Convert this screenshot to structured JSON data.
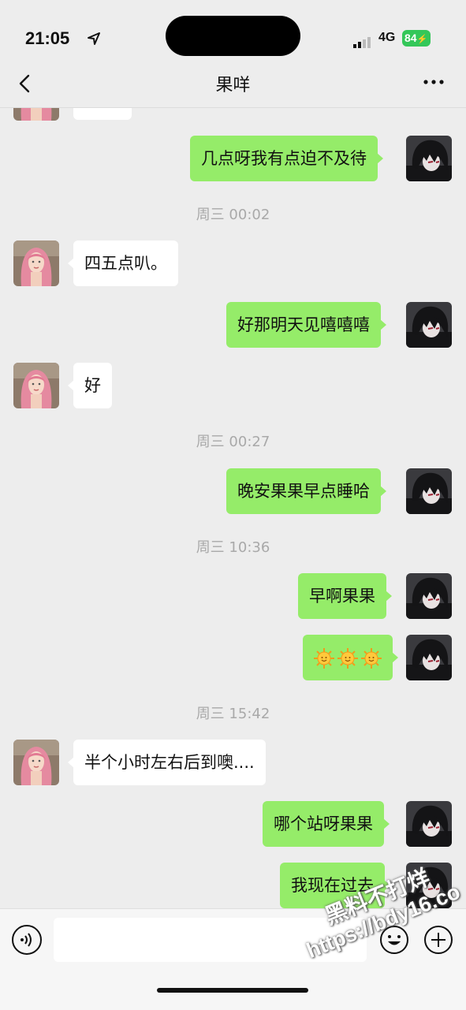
{
  "status_bar": {
    "time": "21:05",
    "network": "4G",
    "battery": "84"
  },
  "nav": {
    "title": "果咩"
  },
  "timestamps": {
    "t1": "周三 00:02",
    "t2": "周三 00:27",
    "t3": "周三 10:36",
    "t4": "周三 15:42"
  },
  "messages": {
    "m1": "几点呀我有点迫不及待",
    "m2": "四五点叭。",
    "m3": "好那明天见嘻嘻嘻",
    "m4": "好",
    "m5": "晚安果果早点睡哈",
    "m6": "早啊果果",
    "m7": "半个小时左右后到噢....",
    "m8": "哪个站呀果果",
    "m9": "我现在过去"
  },
  "watermark": {
    "line1": "黑料不打烊",
    "line2": "https://bdy16.co"
  },
  "colors": {
    "my_bubble": "#95ec69",
    "their_bubble": "#ffffff",
    "background": "#ededed"
  }
}
